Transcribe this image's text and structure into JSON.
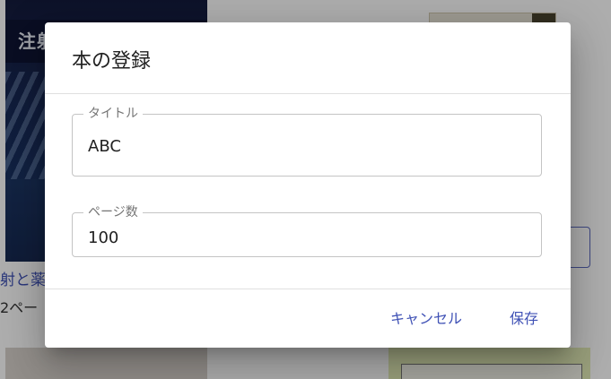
{
  "background": {
    "book1": {
      "cover_text": "注射",
      "title_fragment": "射と薬",
      "pages_fragment": "2ペー"
    }
  },
  "dialog": {
    "title": "本の登録",
    "fields": {
      "title": {
        "label": "タイトル",
        "value": "ABC"
      },
      "pages": {
        "label": "ページ数",
        "value": "100"
      }
    },
    "actions": {
      "cancel_label": "キャンセル",
      "save_label": "保存"
    }
  },
  "colors": {
    "accent": "#3f51b5",
    "scrim": "rgba(0,0,0,0.32)",
    "outline": "#c4c4c4"
  }
}
